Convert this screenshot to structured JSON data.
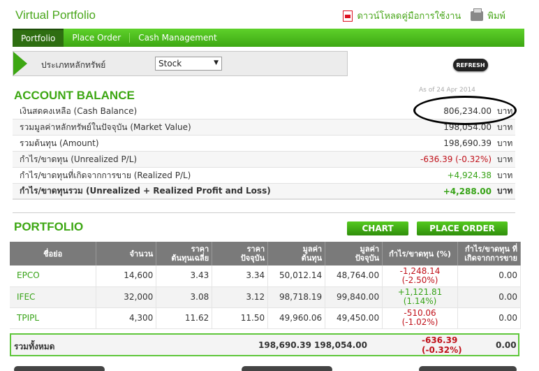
{
  "header": {
    "title": "Virtual Portfolio",
    "download_label": "ดาวน์โหลดคู่มือการใช้งาน",
    "print_label": "พิมพ์"
  },
  "nav": {
    "tabs": [
      {
        "label": "Portfolio"
      },
      {
        "label": "Place Order"
      },
      {
        "label": "Cash Management"
      }
    ]
  },
  "filter": {
    "label": "ประเภทหลักทรัพย์",
    "selected": "Stock"
  },
  "refresh_label": "REFRESH",
  "account": {
    "title": "ACCOUNT BALANCE",
    "as_of": "As of 24 Apr 2014",
    "rows": [
      {
        "label": "เงินสดคงเหลือ (Cash Balance)",
        "value": "806,234.00",
        "unit": "บาท"
      },
      {
        "label": "รวมมูลค่าหลักทรัพย์ในปัจจุบัน (Market Value)",
        "value": "198,054.00",
        "unit": "บาท"
      },
      {
        "label": "รวมต้นทุน (Amount)",
        "value": "198,690.39",
        "unit": "บาท"
      },
      {
        "label": "กำไร/ขาดทุน (Unrealized P/L)",
        "value": "-636.39 (-0.32%)",
        "unit": "บาท"
      },
      {
        "label": "กำไร/ขาดทุนที่เกิดจากการขาย (Realized P/L)",
        "value": "+4,924.38",
        "unit": "บาท"
      },
      {
        "label": "กำไร/ขาดทุนรวม (Unrealized + Realized Profit and Loss)",
        "value": "+4,288.00",
        "unit": "บาท"
      }
    ]
  },
  "portfolio": {
    "title": "PORTFOLIO",
    "chart_label": "CHART",
    "place_order_label": "PLACE ORDER",
    "columns": [
      [
        "ชื่อย่อ",
        ""
      ],
      [
        "จำนวน",
        ""
      ],
      [
        "ราคา",
        "ต้นทุนเฉลี่ย"
      ],
      [
        "ราคา",
        "ปัจจุบัน"
      ],
      [
        "มูลค่า",
        "ต้นทุน"
      ],
      [
        "มูลค่า",
        "ปัจจุบัน"
      ],
      [
        "กำไร/ขาดทุน (%)",
        ""
      ],
      [
        "กำไร/ขาดทุน ที่",
        "เกิดจากการขาย"
      ]
    ],
    "rows": [
      {
        "symbol": "EPCO",
        "qty": "14,600",
        "avg_cost": "3.43",
        "price": "3.34",
        "cost_value": "50,012.14",
        "market_value": "48,764.00",
        "pl": "-1,248.14",
        "pl_pct": "(-2.50%)",
        "realized": "0.00",
        "sign": "neg"
      },
      {
        "symbol": "IFEC",
        "qty": "32,000",
        "avg_cost": "3.08",
        "price": "3.12",
        "cost_value": "98,718.19",
        "market_value": "99,840.00",
        "pl": "+1,121.81",
        "pl_pct": "(1.14%)",
        "realized": "0.00",
        "sign": "pos"
      },
      {
        "symbol": "TPIPL",
        "qty": "4,300",
        "avg_cost": "11.62",
        "price": "11.50",
        "cost_value": "49,960.06",
        "market_value": "49,450.00",
        "pl": "-510.06",
        "pl_pct": "(-1.02%)",
        "realized": "0.00",
        "sign": "neg"
      }
    ],
    "total": {
      "label": "รวมทั้งหมด",
      "cost_value": "198,690.39",
      "market_value": "198,054.00",
      "pl": "-636.39",
      "pl_pct": "(-0.32%)",
      "realized": "0.00"
    }
  },
  "colors": {
    "brand_green": "#3da713",
    "negative": "#c0111a",
    "positive": "#37a317",
    "header_gray": "#7a7a7a"
  }
}
